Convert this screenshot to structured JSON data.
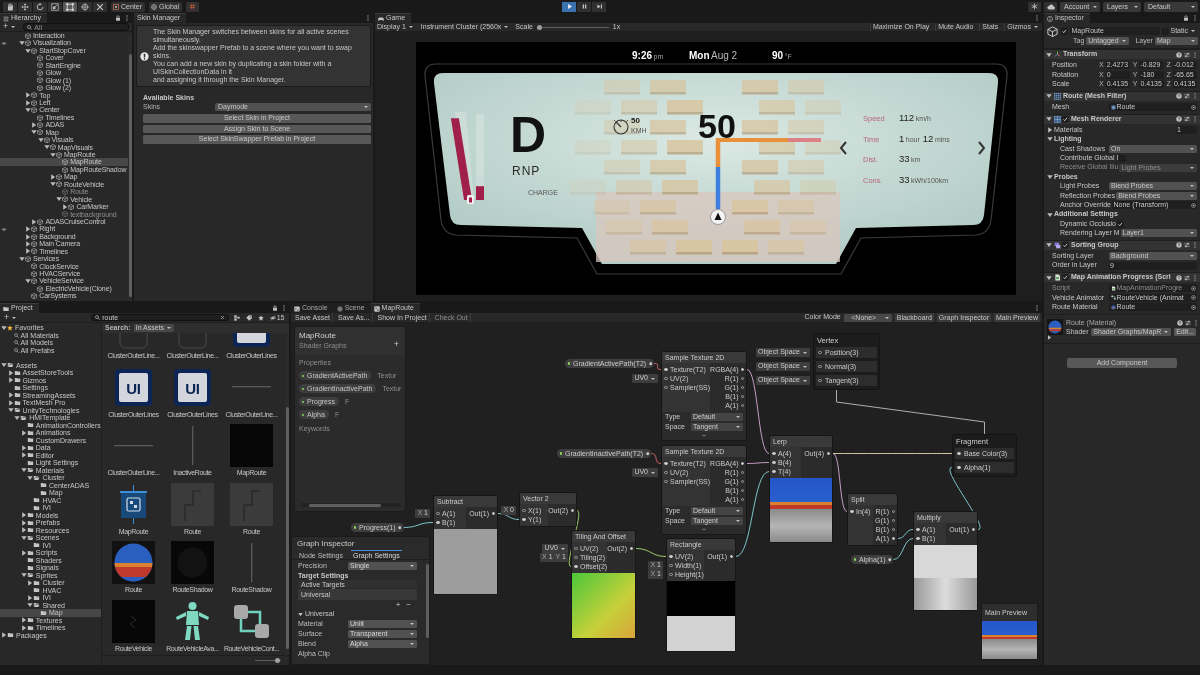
{
  "toolbar": {
    "tools": [
      {
        "kind": "hand",
        "selected": false
      },
      {
        "kind": "move",
        "selected": false
      },
      {
        "kind": "rotate",
        "selected": false
      },
      {
        "kind": "scale",
        "selected": false
      },
      {
        "kind": "rect",
        "selected": true
      },
      {
        "kind": "transform",
        "selected": false
      },
      {
        "kind": "custom",
        "selected": false
      }
    ],
    "pivot": "Center",
    "space": "Global",
    "play": [
      {
        "kind": "play",
        "selected": true
      },
      {
        "kind": "pause",
        "selected": false
      },
      {
        "kind": "step",
        "selected": false
      }
    ],
    "menus": [
      "Account",
      "Layers",
      "Default"
    ]
  },
  "hierarchy": {
    "title": "Hierarchy",
    "add": "+",
    "search": {
      "placeholder": "All"
    },
    "items": [
      {
        "label": "Interaction",
        "selected": false,
        "disabled": false,
        "hidden_in_scene": false
      },
      {
        "label": "Visualization",
        "selected": false,
        "disabled": false,
        "hidden_in_scene": true,
        "expanded": true,
        "children": [
          {
            "label": "StartStopCover",
            "selected": false,
            "disabled": false,
            "hidden_in_scene": false,
            "expanded": true,
            "children": [
              {
                "label": "Cover",
                "selected": false,
                "disabled": false,
                "hidden_in_scene": false
              },
              {
                "label": "StartEngine",
                "selected": false,
                "disabled": false,
                "hidden_in_scene": false
              },
              {
                "label": "Glow",
                "selected": false,
                "disabled": false,
                "hidden_in_scene": false
              },
              {
                "label": "Glow (1)",
                "selected": false,
                "disabled": false,
                "hidden_in_scene": false
              },
              {
                "label": "Glow (2)",
                "selected": false,
                "disabled": false,
                "hidden_in_scene": false
              }
            ]
          },
          {
            "label": "Top",
            "selected": false,
            "disabled": false,
            "hidden_in_scene": false,
            "expanded": false
          },
          {
            "label": "Left",
            "selected": false,
            "disabled": false,
            "hidden_in_scene": false,
            "expanded": false
          },
          {
            "label": "Center",
            "selected": false,
            "disabled": false,
            "hidden_in_scene": false,
            "expanded": true,
            "children": [
              {
                "label": "Timelines",
                "selected": false,
                "disabled": false,
                "hidden_in_scene": false
              },
              {
                "label": "ADAS",
                "selected": false,
                "disabled": false,
                "hidden_in_scene": false,
                "expanded": false
              },
              {
                "label": "Map",
                "selected": false,
                "disabled": false,
                "hidden_in_scene": false,
                "expanded": true,
                "children": [
                  {
                    "label": "Visuals",
                    "selected": false,
                    "disabled": false,
                    "hidden_in_scene": false,
                    "expanded": true,
                    "children": [
                      {
                        "label": "MapVisuals",
                        "selected": false,
                        "disabled": false,
                        "hidden_in_scene": false,
                        "expanded": true,
                        "children": [
                          {
                            "label": "MapRoute",
                            "selected": false,
                            "disabled": false,
                            "hidden_in_scene": false,
                            "expanded": true,
                            "children": [
                              {
                                "label": "MapRoute",
                                "selected": true,
                                "disabled": false,
                                "hidden_in_scene": false
                              },
                              {
                                "label": "MapRouteShadow",
                                "selected": false,
                                "disabled": false,
                                "hidden_in_scene": false
                              }
                            ]
                          },
                          {
                            "label": "Map",
                            "selected": false,
                            "disabled": false,
                            "hidden_in_scene": false,
                            "expanded": false
                          },
                          {
                            "label": "RouteVehicle",
                            "selected": false,
                            "disabled": false,
                            "hidden_in_scene": false,
                            "expanded": true,
                            "children": [
                              {
                                "label": "Route",
                                "selected": false,
                                "disabled": true,
                                "hidden_in_scene": false
                              },
                              {
                                "label": "Vehicle",
                                "selected": false,
                                "disabled": false,
                                "hidden_in_scene": false,
                                "expanded": true,
                                "children": [
                                  {
                                    "label": "CarMarker",
                                    "selected": false,
                                    "disabled": false,
                                    "hidden_in_scene": false,
                                    "expanded": false
                                  }
                                ]
                              },
                              {
                                "label": "textbackground",
                                "selected": false,
                                "disabled": true,
                                "hidden_in_scene": false
                              }
                            ]
                          }
                        ]
                      }
                    ]
                  }
                ]
              },
              {
                "label": "ADASCruiseControl",
                "selected": false,
                "disabled": false,
                "hidden_in_scene": false,
                "expanded": false
              }
            ]
          },
          {
            "label": "Right",
            "selected": false,
            "disabled": false,
            "hidden_in_scene": true,
            "expanded": false
          },
          {
            "label": "Background",
            "selected": false,
            "disabled": false,
            "hidden_in_scene": false,
            "expanded": false
          },
          {
            "label": "Main Camera",
            "selected": false,
            "disabled": false,
            "hidden_in_scene": false,
            "expanded": false
          },
          {
            "label": "Timelines",
            "selected": false,
            "disabled": false,
            "hidden_in_scene": false,
            "expanded": false
          }
        ]
      },
      {
        "label": "Services",
        "selected": false,
        "disabled": false,
        "hidden_in_scene": false,
        "expanded": true,
        "children": [
          {
            "label": "ClockService",
            "selected": false,
            "disabled": false,
            "hidden_in_scene": false
          },
          {
            "label": "HVACService",
            "selected": false,
            "disabled": false,
            "hidden_in_scene": false
          },
          {
            "label": "VehicleService",
            "selected": false,
            "disabled": false,
            "hidden_in_scene": false,
            "expanded": true,
            "children": [
              {
                "label": "ElectricVehicle(Clone)",
                "selected": false,
                "disabled": false,
                "hidden_in_scene": false
              }
            ]
          },
          {
            "label": "CarSystems",
            "selected": false,
            "disabled": false,
            "hidden_in_scene": false
          }
        ]
      }
    ]
  },
  "skin_manager": {
    "title": "Skin Manager",
    "info": "The Skin Manager switches between skins for all active scenes simultaneously.\nAdd the skinswapper Prefab to a scene where you want to swap skins.\nYou can add a new skin by duplicating a skin folder with a UISkinCollectionData in it\nand assigning it through the Skin Manager.",
    "heading": "Available Skins",
    "skins_label": "Skins",
    "skins": "Daymode",
    "buttons": [
      "Select Skin in Project",
      "Assign Skin to Scene",
      "Select SkinSwapper Prefab in Project"
    ]
  },
  "game": {
    "title": "Game",
    "display": "Display 1",
    "target": "Instrument Cluster (2560x",
    "scale_label": "Scale",
    "scale": {
      "level": 0
    },
    "scale_reading": "1x",
    "buttons": [
      "Maximize On Play",
      "Mute Audio",
      "Stats"
    ],
    "gizmos": "Gizmos",
    "cluster": {
      "clock": {
        "time": "9:26",
        "suffix": "pm"
      },
      "date": {
        "day": "Mon",
        "date": "Aug 2"
      },
      "temperature": {
        "value": "90",
        "unit": "°F"
      },
      "gear": "D",
      "gear_options": "RNP",
      "gauges": [
        {
          "level": 0.95
        },
        {
          "level": 0.16
        }
      ],
      "gauge_label": "CHARGE",
      "speed_limit": {
        "value": "50",
        "unit": "KMH"
      },
      "speed": "50",
      "trip": [
        {
          "label": "Speed",
          "parts": [
            {
              "value": "112",
              "unit": "km/h"
            }
          ]
        },
        {
          "label": "Time",
          "parts": [
            {
              "value": "1",
              "unit": "hour"
            },
            {
              "value": "12",
              "unit": "mins"
            }
          ]
        },
        {
          "label": "Dist.",
          "parts": [
            {
              "value": "33",
              "unit": "km"
            }
          ]
        },
        {
          "label": "Cons.",
          "parts": [
            {
              "value": "33",
              "unit": "kWh/100km"
            }
          ]
        }
      ]
    }
  },
  "inspector": {
    "title": "Inspector",
    "object": {
      "active": true,
      "name": "MapRoute",
      "static": false,
      "static_label": "Static",
      "tag_label": "Tag",
      "tag": "Untagged",
      "layer_label": "Layer",
      "layer": "Map"
    },
    "components": [
      {
        "kind": "transform",
        "title": "Transform",
        "expanded": true,
        "rows": [
          {
            "kind": "vector",
            "label": "Position",
            "fields": [
              {
                "axis": "X",
                "value": "2.4273"
              },
              {
                "axis": "Y",
                "value": "-0.829"
              },
              {
                "axis": "Z",
                "value": "-0.012"
              }
            ]
          },
          {
            "kind": "vector",
            "label": "Rotation",
            "fields": [
              {
                "axis": "X",
                "value": "0"
              },
              {
                "axis": "Y",
                "value": "-180"
              },
              {
                "axis": "Z",
                "value": "-65.65"
              }
            ]
          },
          {
            "kind": "vector",
            "label": "Scale",
            "fields": [
              {
                "axis": "X",
                "value": "0.4135"
              },
              {
                "axis": "Y",
                "value": "0.4135"
              },
              {
                "axis": "Z",
                "value": "0.4135"
              }
            ]
          }
        ]
      },
      {
        "kind": "mesh_filter",
        "title": "Route (Mesh Filter)",
        "expanded": true,
        "rows": [
          {
            "kind": "object",
            "label": "Mesh",
            "value": "Route"
          }
        ]
      },
      {
        "kind": "mesh_renderer",
        "title": "Mesh Renderer",
        "enabled": true,
        "expanded": true,
        "rows": [
          {
            "kind": "foldout",
            "label": "Materials",
            "expanded": false,
            "value": "1"
          },
          {
            "kind": "section",
            "label": "Lighting",
            "expanded": true,
            "children": [
              {
                "kind": "dropdown",
                "label": "Cast Shadows",
                "value": "On",
                "disabled": false
              },
              {
                "kind": "checkbox",
                "label": "Contribute Global I",
                "checked": false,
                "disabled": false
              },
              {
                "kind": "dropdown",
                "label": "Receive Global Illu",
                "value": "Light Probes",
                "disabled": true
              }
            ]
          },
          {
            "kind": "section",
            "label": "Probes",
            "expanded": true,
            "children": [
              {
                "kind": "dropdown",
                "label": "Light Probes",
                "value": "Blend Probes"
              },
              {
                "kind": "dropdown",
                "label": "Reflection Probes",
                "value": "Blend Probes"
              },
              {
                "kind": "object",
                "label": "Anchor Override",
                "value": "None (Transform)"
              }
            ]
          },
          {
            "kind": "section",
            "label": "Additional Settings",
            "expanded": true,
            "children": [
              {
                "kind": "checkbox",
                "label": "Dynamic Occlusio",
                "checked": true
              },
              {
                "kind": "dropdown",
                "label": "Rendering Layer M",
                "value": "Layer1"
              }
            ]
          }
        ]
      },
      {
        "kind": "sorting_group",
        "title": "Sorting Group",
        "enabled": true,
        "expanded": true,
        "rows": [
          {
            "kind": "dropdown",
            "label": "Sorting Layer",
            "value": "Background"
          },
          {
            "kind": "text",
            "label": "Order in Layer",
            "value": "9"
          }
        ]
      },
      {
        "kind": "script",
        "title": "Map Animation Progress (Scri",
        "enabled": true,
        "expanded": true,
        "rows": [
          {
            "kind": "object",
            "label": "Script",
            "value": "MapAnimationProgre",
            "disabled": true
          },
          {
            "kind": "object",
            "label": "Vehicle Animator",
            "value": "RouteVehicle (Animat",
            "disabled": false
          },
          {
            "kind": "object",
            "label": "Route Material",
            "value": "Route",
            "disabled": false
          }
        ]
      },
      {
        "kind": "material",
        "title": "Route (Material)",
        "expanded": false,
        "shader_label": "Shader",
        "shader": "Shader Graphs/MapR",
        "edit": "Edit..."
      }
    ],
    "add_component": "Add Component"
  },
  "project": {
    "title": "Project",
    "add": "+",
    "search": {
      "value": "route"
    },
    "hidden_count": "15",
    "tree": [
      {
        "label": "Favorites",
        "kind": "favorites",
        "selected": false,
        "expanded": true,
        "children": [
          {
            "label": "All Materials",
            "kind": "search",
            "selected": false
          },
          {
            "label": "All Models",
            "kind": "search",
            "selected": false
          },
          {
            "label": "All Prefabs",
            "kind": "search",
            "selected": false
          }
        ]
      },
      {
        "label": "Assets",
        "kind": "folder",
        "selected": false,
        "expanded": true,
        "children": [
          {
            "label": "AssetStoreTools",
            "kind": "folder",
            "selected": false,
            "expanded": false
          },
          {
            "label": "Gizmos",
            "kind": "folder",
            "selected": false,
            "expanded": false
          },
          {
            "label": "Settings",
            "kind": "folder",
            "selected": false
          },
          {
            "label": "StreamingAssets",
            "kind": "folder",
            "selected": false,
            "expanded": false
          },
          {
            "label": "TextMesh Pro",
            "kind": "folder",
            "selected": false,
            "expanded": false
          },
          {
            "label": "UnityTechnologies",
            "kind": "folder",
            "selected": false,
            "expanded": true,
            "children": [
              {
                "label": "HMITemplate",
                "kind": "folder",
                "selected": false,
                "expanded": true,
                "children": [
                  {
                    "label": "AnimationControllers",
                    "kind": "folder",
                    "selected": false
                  },
                  {
                    "label": "Animations",
                    "kind": "folder",
                    "selected": false,
                    "expanded": false
                  },
                  {
                    "label": "CustomDrawers",
                    "kind": "folder",
                    "selected": false
                  },
                  {
                    "label": "Data",
                    "kind": "folder",
                    "selected": false,
                    "expanded": false
                  },
                  {
                    "label": "Editor",
                    "kind": "folder",
                    "selected": false,
                    "expanded": false
                  },
                  {
                    "label": "Light Settings",
                    "kind": "folder",
                    "selected": false
                  },
                  {
                    "label": "Materials",
                    "kind": "folder",
                    "selected": false,
                    "expanded": true,
                    "children": [
                      {
                        "label": "Cluster",
                        "kind": "folder",
                        "selected": false,
                        "expanded": true,
                        "children": [
                          {
                            "label": "CenterADAS",
                            "kind": "folder",
                            "selected": false
                          },
                          {
                            "label": "Map",
                            "kind": "folder",
                            "selected": false
                          }
                        ]
                      },
                      {
                        "label": "HVAC",
                        "kind": "folder",
                        "selected": false
                      },
                      {
                        "label": "IVI",
                        "kind": "folder",
                        "selected": false
                      }
                    ]
                  },
                  {
                    "label": "Models",
                    "kind": "folder",
                    "selected": false,
                    "expanded": false
                  },
                  {
                    "label": "Prefabs",
                    "kind": "folder",
                    "selected": false,
                    "expanded": false
                  },
                  {
                    "label": "Resources",
                    "kind": "folder",
                    "selected": false,
                    "expanded": false
                  },
                  {
                    "label": "Scenes",
                    "kind": "folder",
                    "selected": false,
                    "expanded": true,
                    "children": [
                      {
                        "label": "IVI",
                        "kind": "folder",
                        "selected": false
                      }
                    ]
                  },
                  {
                    "label": "Scripts",
                    "kind": "folder",
                    "selected": false,
                    "expanded": false
                  },
                  {
                    "label": "Shaders",
                    "kind": "folder",
                    "selected": false
                  },
                  {
                    "label": "Signals",
                    "kind": "folder",
                    "selected": false
                  },
                  {
                    "label": "Sprites",
                    "kind": "folder",
                    "selected": false,
                    "expanded": true,
                    "children": [
                      {
                        "label": "Cluster",
                        "kind": "folder",
                        "selected": false,
                        "expanded": false
                      },
                      {
                        "label": "HVAC",
                        "kind": "folder",
                        "selected": false
                      },
                      {
                        "label": "IVI",
                        "kind": "folder",
                        "selected": false,
                        "expanded": false
                      },
                      {
                        "label": "Shared",
                        "kind": "folder",
                        "selected": false,
                        "expanded": true,
                        "children": [
                          {
                            "label": "Map",
                            "kind": "folder",
                            "selected": true
                          }
                        ]
                      }
                    ]
                  },
                  {
                    "label": "Textures",
                    "kind": "folder",
                    "selected": false,
                    "expanded": false
                  },
                  {
                    "label": "Timelines",
                    "kind": "folder",
                    "selected": false,
                    "expanded": false
                  }
                ]
              }
            ]
          }
        ]
      },
      {
        "label": "Packages",
        "kind": "folder",
        "selected": false,
        "expanded": false
      }
    ],
    "scope_label": "Search:",
    "scope": "In Assets",
    "assets": [
      {
        "label": "ClusterOuterLine...",
        "kind": "frame",
        "selected": false
      },
      {
        "label": "ClusterOuterLine...",
        "kind": "frame",
        "selected": false
      },
      {
        "label": "ClusterOuterLines",
        "kind": "ui_sprite",
        "selected": false
      },
      {
        "label": "ClusterOuterLines",
        "kind": "ui_sprite",
        "thumb_text": "UI",
        "selected": false
      },
      {
        "label": "ClusterOuterLines",
        "kind": "ui_sprite",
        "thumb_text": "UI",
        "selected": false
      },
      {
        "label": "ClusterOuterLine...",
        "kind": "line_h",
        "selected": false
      },
      {
        "label": "ClusterOuterLine...",
        "kind": "line_h",
        "selected": false
      },
      {
        "label": "InactiveRoute",
        "kind": "line_v",
        "selected": false
      },
      {
        "label": "MapRoute",
        "kind": "black",
        "selected": false
      },
      {
        "label": "MapRoute",
        "kind": "shader_graph",
        "selected": false
      },
      {
        "label": "Route",
        "kind": "route_sprite",
        "selected": false
      },
      {
        "label": "Route",
        "kind": "route_sprite",
        "selected": false
      },
      {
        "label": "Route",
        "kind": "sphere",
        "selected": false
      },
      {
        "label": "RouteShadow",
        "kind": "shadow",
        "selected": false
      },
      {
        "label": "RouteShadow",
        "kind": "line_v",
        "selected": false
      },
      {
        "label": "RouteVehicle",
        "kind": "vehicle",
        "selected": false
      },
      {
        "label": "RouteVehicleAva...",
        "kind": "avatar",
        "selected": false
      },
      {
        "label": "RouteVehicleCont...",
        "kind": "controller",
        "selected": false
      }
    ],
    "size_slider": {
      "level": 0.95
    }
  },
  "shader_graph": {
    "tabs": [
      {
        "label": "Console",
        "kind": "console",
        "selected": false
      },
      {
        "label": "Scene",
        "kind": "scene",
        "selected": false
      },
      {
        "label": "MapRoute",
        "kind": "shader",
        "selected": true
      }
    ],
    "toolbar": [
      {
        "label": "Save Asset",
        "disabled": false
      },
      {
        "label": "Save As...",
        "disabled": false
      },
      {
        "label": "Show In Project",
        "disabled": false
      },
      {
        "label": "Check Out",
        "disabled": true
      }
    ],
    "color_mode_label": "Color Mode",
    "color_mode": "<None>",
    "toggles": [
      "Blackboard",
      "Graph Inspector",
      "Main Preview"
    ],
    "blackboard": {
      "title": "MapRoute",
      "subtitle": "Shader Graphs",
      "add": "+",
      "properties_label": "Properties",
      "properties": [
        {
          "name": "GradientActivePath",
          "type": "Textur"
        },
        {
          "name": "GradientInactivePath",
          "type": "Textur"
        },
        {
          "name": "Progress",
          "type": "F"
        },
        {
          "name": "Alpha",
          "type": "F"
        }
      ],
      "keywords_label": "Keywords"
    },
    "graph_inspector": {
      "title": "Graph Inspector",
      "tabs": [
        {
          "label": "Node Settings",
          "selected": false
        },
        {
          "label": "Graph Settings",
          "selected": true
        }
      ],
      "precision_label": "Precision",
      "precision": "Single",
      "target_heading": "Target Settings",
      "targets_label": "Active Targets",
      "targets": [
        "Universal"
      ],
      "list_buttons": [
        "+",
        "−"
      ],
      "section": {
        "label": "Universal",
        "expanded": true
      },
      "rows": [
        {
          "label": "Material",
          "value": "Unlit"
        },
        {
          "label": "Surface",
          "value": "Transparent"
        },
        {
          "label": "Blend",
          "value": "Alpha"
        },
        {
          "label": "Alpha Clip"
        }
      ]
    },
    "nodes": [
      {
        "kind": "property",
        "label": "GradientActivePath(T2)"
      },
      {
        "kind": "node",
        "title": "Sample Texture 2D",
        "inputs": [
          {
            "label": "Texture(T2)",
            "connected": true
          },
          {
            "label": "UV(2)",
            "connected": false,
            "default": {
              "kind": "dropdown",
              "value": "UV0"
            }
          },
          {
            "label": "Sampler(SS)",
            "connected": false
          }
        ],
        "outputs": [
          {
            "label": "RGBA(4)",
            "connected": true
          },
          {
            "label": "R(1)",
            "connected": false
          },
          {
            "label": "G(1)",
            "connected": false
          },
          {
            "label": "B(1)",
            "connected": false
          },
          {
            "label": "A(1)",
            "connected": false
          }
        ],
        "settings": [
          {
            "label": "Type",
            "value": "Default"
          },
          {
            "label": "Space",
            "value": "Tangent"
          }
        ],
        "expanded": false
      },
      {
        "kind": "block",
        "title": "Vertex",
        "ports": [
          {
            "label": "Position(3)",
            "connected": false,
            "default": {
              "kind": "dropdown",
              "value": "Object Space"
            }
          },
          {
            "label": "Normal(3)",
            "connected": false,
            "default": {
              "kind": "dropdown",
              "value": "Object Space"
            }
          },
          {
            "label": "Tangent(3)",
            "connected": false,
            "default": {
              "kind": "dropdown",
              "value": "Object Space"
            }
          }
        ]
      },
      {
        "kind": "property",
        "label": "GradientInactivePath(T2)"
      },
      {
        "kind": "node",
        "title": "Sample Texture 2D",
        "inputs": [
          {
            "label": "Texture(T2)",
            "connected": true
          },
          {
            "label": "UV(2)",
            "connected": false,
            "default": {
              "kind": "dropdown",
              "value": "UV0"
            }
          },
          {
            "label": "Sampler(SS)",
            "connected": false
          }
        ],
        "outputs": [
          {
            "label": "RGBA(4)",
            "connected": true
          },
          {
            "label": "R(1)",
            "connected": false
          },
          {
            "label": "G(1)",
            "connected": false
          },
          {
            "label": "B(1)",
            "connected": false
          },
          {
            "label": "A(1)",
            "connected": false
          }
        ],
        "settings": [
          {
            "label": "Type",
            "value": "Default"
          },
          {
            "label": "Space",
            "value": "Tangent"
          }
        ],
        "expanded": false
      },
      {
        "kind": "node",
        "title": "Lerp",
        "inputs": [
          {
            "label": "A(4)",
            "connected": true
          },
          {
            "label": "B(4)",
            "connected": true
          },
          {
            "label": "T(4)",
            "connected": true
          }
        ],
        "outputs": [
          {
            "label": "Out(4)",
            "connected": true
          }
        ],
        "expanded": true
      },
      {
        "kind": "block",
        "title": "Fragment",
        "ports": [
          {
            "label": "Base Color(3)",
            "connected": true
          },
          {
            "label": "Alpha(1)",
            "connected": true
          }
        ]
      },
      {
        "kind": "property",
        "label": "Progress(1)"
      },
      {
        "kind": "node",
        "title": "Subtract",
        "inputs": [
          {
            "label": "A(1)",
            "connected": false,
            "default": {
              "kind": "vector",
              "fields": [
                {
                  "axis": "X",
                  "value": "1"
                }
              ]
            }
          },
          {
            "label": "B(1)",
            "connected": true
          }
        ],
        "outputs": [
          {
            "label": "Out(1)",
            "connected": true
          }
        ],
        "expanded": true
      },
      {
        "kind": "node",
        "title": "Vector 2",
        "inputs": [
          {
            "label": "X(1)",
            "connected": false,
            "default": {
              "kind": "vector",
              "fields": [
                {
                  "axis": "X",
                  "value": "0"
                }
              ]
            }
          },
          {
            "label": "Y(1)",
            "connected": true
          }
        ],
        "outputs": [
          {
            "label": "Out(2)",
            "connected": true
          }
        ]
      },
      {
        "kind": "node",
        "title": "Tiling And Offset",
        "inputs": [
          {
            "label": "UV(2)",
            "connected": false,
            "default": {
              "kind": "dropdown",
              "value": "UV0"
            }
          },
          {
            "label": "Tiling(2)",
            "connected": false,
            "default": {
              "kind": "vector",
              "fields": [
                {
                  "axis": "X",
                  "value": "1"
                },
                {
                  "axis": "Y",
                  "value": "1"
                }
              ]
            }
          },
          {
            "label": "Offset(2)",
            "connected": true
          }
        ],
        "outputs": [
          {
            "label": "Out(2)",
            "connected": true
          }
        ],
        "expanded": true
      },
      {
        "kind": "node",
        "title": "Rectangle",
        "inputs": [
          {
            "label": "UV(2)",
            "connected": true
          },
          {
            "label": "Width(1)",
            "connected": false,
            "default": {
              "kind": "vector",
              "fields": [
                {
                  "axis": "X",
                  "value": "1"
                }
              ]
            }
          },
          {
            "label": "Height(1)",
            "connected": false,
            "default": {
              "kind": "vector",
              "fields": [
                {
                  "axis": "X",
                  "value": "1"
                }
              ]
            }
          }
        ],
        "outputs": [
          {
            "label": "Out(1)",
            "connected": true
          }
        ],
        "expanded": true
      },
      {
        "kind": "node",
        "title": "Split",
        "inputs": [
          {
            "label": "In(4)",
            "connected": true
          }
        ],
        "outputs": [
          {
            "label": "R(1)",
            "connected": false
          },
          {
            "label": "G(1)",
            "connected": false
          },
          {
            "label": "B(1)",
            "connected": false
          },
          {
            "label": "A(1)",
            "connected": true
          }
        ]
      },
      {
        "kind": "property",
        "label": "Alpha(1)"
      },
      {
        "kind": "node",
        "title": "Multiply",
        "inputs": [
          {
            "label": "A(1)",
            "connected": true
          },
          {
            "label": "B(1)",
            "connected": true
          }
        ],
        "outputs": [
          {
            "label": "Out(1)",
            "connected": true
          }
        ],
        "expanded": true
      }
    ],
    "main_preview": {
      "title": "Main Preview"
    }
  }
}
